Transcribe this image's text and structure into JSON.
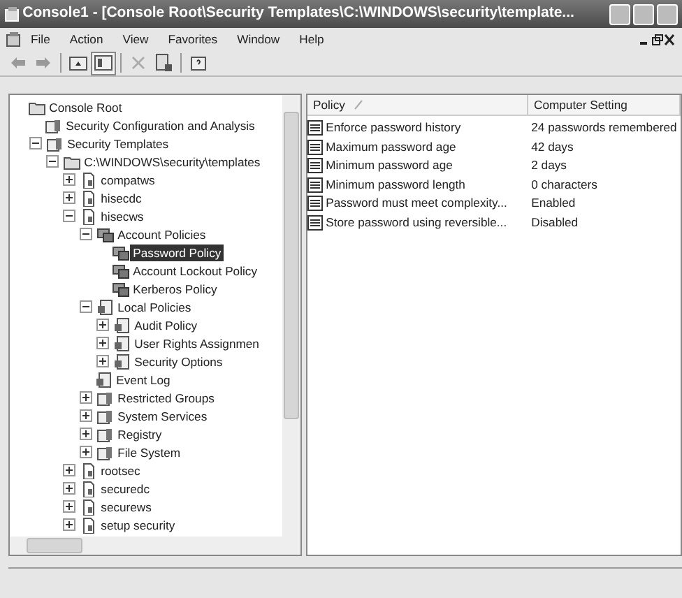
{
  "window": {
    "title": "Console1 - [Console Root\\Security Templates\\C:\\WINDOWS\\security\\template..."
  },
  "menu": [
    "File",
    "Action",
    "View",
    "Favorites",
    "Window",
    "Help"
  ],
  "toolbar": [
    {
      "kind": "back"
    },
    {
      "kind": "forward"
    },
    {
      "kind": "sep"
    },
    {
      "kind": "up"
    },
    {
      "kind": "tree",
      "pressed": true
    },
    {
      "kind": "sep"
    },
    {
      "kind": "delete"
    },
    {
      "kind": "export"
    },
    {
      "kind": "sep"
    },
    {
      "kind": "help"
    }
  ],
  "tree": [
    {
      "label": "Console Root",
      "kind": "folder",
      "selected": false,
      "children": [
        {
          "label": "Security Configuration and Analysis",
          "kind": "template",
          "selected": false
        },
        {
          "label": "Security Templates",
          "kind": "template",
          "expanded": true,
          "selected": false,
          "children": [
            {
              "label": "C:\\WINDOWS\\security\\templates",
              "kind": "folder",
              "expanded": true,
              "selected": false,
              "children": [
                {
                  "label": "compatws",
                  "kind": "doc",
                  "expanded": false,
                  "selected": false
                },
                {
                  "label": "hisecdc",
                  "kind": "doc",
                  "expanded": false,
                  "selected": false
                },
                {
                  "label": "hisecws",
                  "kind": "doc",
                  "expanded": true,
                  "selected": false,
                  "children": [
                    {
                      "label": "Account Policies",
                      "kind": "policy",
                      "expanded": true,
                      "selected": false,
                      "children": [
                        {
                          "label": "Password Policy",
                          "kind": "policy",
                          "selected": true
                        },
                        {
                          "label": "Account Lockout Policy",
                          "kind": "policy",
                          "selected": false
                        },
                        {
                          "label": "Kerberos Policy",
                          "kind": "policy",
                          "selected": false
                        }
                      ]
                    },
                    {
                      "label": "Local Policies",
                      "kind": "local",
                      "expanded": true,
                      "selected": false,
                      "children": [
                        {
                          "label": "Audit Policy",
                          "kind": "local",
                          "expanded": false,
                          "selected": false
                        },
                        {
                          "label": "User Rights Assignmen",
                          "kind": "local",
                          "expanded": false,
                          "selected": false
                        },
                        {
                          "label": "Security Options",
                          "kind": "local",
                          "expanded": false,
                          "selected": false
                        }
                      ]
                    },
                    {
                      "label": "Event Log",
                      "kind": "local",
                      "selected": false
                    },
                    {
                      "label": "Restricted Groups",
                      "kind": "template",
                      "expanded": false,
                      "selected": false
                    },
                    {
                      "label": "System Services",
                      "kind": "template",
                      "expanded": false,
                      "selected": false
                    },
                    {
                      "label": "Registry",
                      "kind": "template",
                      "expanded": false,
                      "selected": false
                    },
                    {
                      "label": "File System",
                      "kind": "template",
                      "expanded": false,
                      "selected": false
                    }
                  ]
                },
                {
                  "label": "rootsec",
                  "kind": "doc",
                  "expanded": false,
                  "selected": false
                },
                {
                  "label": "securedc",
                  "kind": "doc",
                  "expanded": false,
                  "selected": false
                },
                {
                  "label": "securews",
                  "kind": "doc",
                  "expanded": false,
                  "selected": false
                },
                {
                  "label": "setup security",
                  "kind": "doc",
                  "expanded": false,
                  "selected": false
                }
              ]
            }
          ]
        }
      ]
    }
  ],
  "columns": [
    {
      "label": "Policy",
      "sorted": true
    },
    {
      "label": "Computer Setting",
      "sorted": false
    }
  ],
  "rows": [
    {
      "policy": "Enforce password history",
      "setting": "24 passwords remembered"
    },
    {
      "policy": "Maximum password age",
      "setting": "42 days"
    },
    {
      "policy": "Minimum password age",
      "setting": "2 days"
    },
    {
      "policy": "Minimum password length",
      "setting": "0 characters"
    },
    {
      "policy": "Password must meet complexity...",
      "setting": "Enabled"
    },
    {
      "policy": "Store password using reversible...",
      "setting": "Disabled"
    }
  ]
}
